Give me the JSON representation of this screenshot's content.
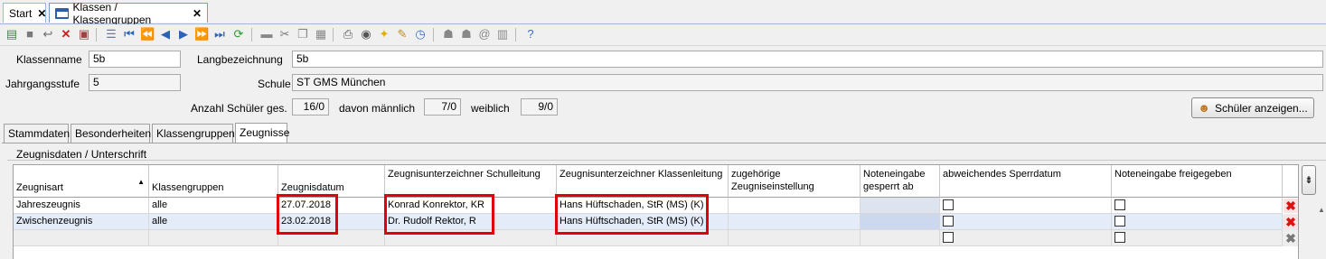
{
  "tabs": [
    {
      "label": "Start",
      "close": "✕"
    },
    {
      "label": "Klassen / Klassengruppen",
      "close": "✕"
    }
  ],
  "form": {
    "klassenname_label": "Klassenname",
    "klassenname_value": "5b",
    "langbez_label": "Langbezeichnung",
    "langbez_value": "5b",
    "jahrgang_label": "Jahrgangsstufe",
    "jahrgang_value": "5",
    "schule_label": "Schule",
    "schule_value": "ST GMS München",
    "anzahl_label": "Anzahl Schüler ges.",
    "anzahl_value": "16/0",
    "maennlich_label": "davon männlich",
    "maennlich_value": "7/0",
    "weiblich_label": "weiblich",
    "weiblich_value": "9/0",
    "show_students_button": "Schüler anzeigen..."
  },
  "subtabs": [
    "Stammdaten",
    "Besonderheiten",
    "Klassengruppen",
    "Zeugnisse"
  ],
  "group_title": "Zeugnisdaten / Unterschrift",
  "grid": {
    "headers": [
      "Zeugnisart",
      "Klassengruppen",
      "Zeugnisdatum",
      "Zeugnisunterzeichner Schulleitung",
      "Zeugnisunterzeichner Klassenleitung",
      "zugehörige Zeugniseinstellung",
      "Noteneingabe gesperrt ab",
      "abweichendes Sperrdatum",
      "Noteneingabe freigegeben"
    ],
    "rows": [
      {
        "art": "Jahreszeugnis",
        "gruppen": "alle",
        "datum": "27.07.2018",
        "schulleitung": "Konrad Konrektor, KR",
        "klassenleitung": "Hans Hüftschaden, StR (MS) (K)"
      },
      {
        "art": "Zwischenzeugnis",
        "gruppen": "alle",
        "datum": "23.02.2018",
        "schulleitung": "Dr. Rudolf Rektor, R",
        "klassenleitung": "Hans Hüftschaden, StR (MS) (K)"
      },
      {
        "art": "",
        "gruppen": "",
        "datum": "",
        "schulleitung": "",
        "klassenleitung": ""
      }
    ]
  },
  "colors": {
    "highlight": "#e0000b",
    "selected_row": "#e3ecf8",
    "locked_cell": "#dde4f0"
  }
}
